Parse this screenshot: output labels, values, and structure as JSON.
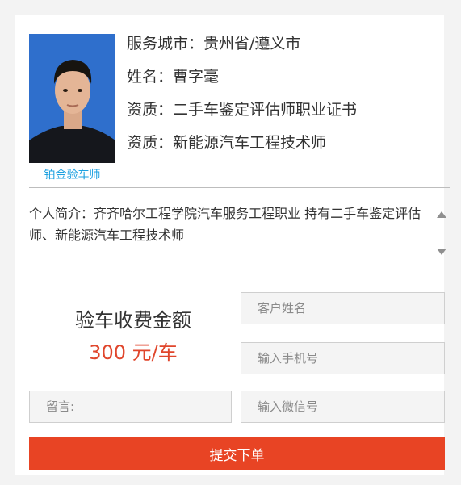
{
  "profile": {
    "photo_alt": "inspector-photo",
    "badge": "铂金验车师",
    "service_city": "服务城市：贵州省/遵义市",
    "name": "姓名：曹字毫",
    "qualification_1": "资质：二手车鉴定评估师职业证书",
    "qualification_2": "资质：新能源汽车工程技术师"
  },
  "intro": {
    "text": "个人简介：齐齐哈尔工程学院汽车服务工程职业 持有二手车鉴定评估师、新能源汽车工程技术师"
  },
  "price": {
    "title": "验车收费金额",
    "value": "300 元/车"
  },
  "form": {
    "name_placeholder": "客户姓名",
    "phone_placeholder": "输入手机号",
    "message_placeholder": "留言:",
    "wechat_placeholder": "输入微信号",
    "submit_label": "提交下单"
  },
  "colors": {
    "accent": "#e84424",
    "price": "#e0462c",
    "badge": "#1da1e0"
  },
  "icons": {
    "scroll_up": "triangle-up-icon",
    "scroll_down": "triangle-down-icon"
  }
}
